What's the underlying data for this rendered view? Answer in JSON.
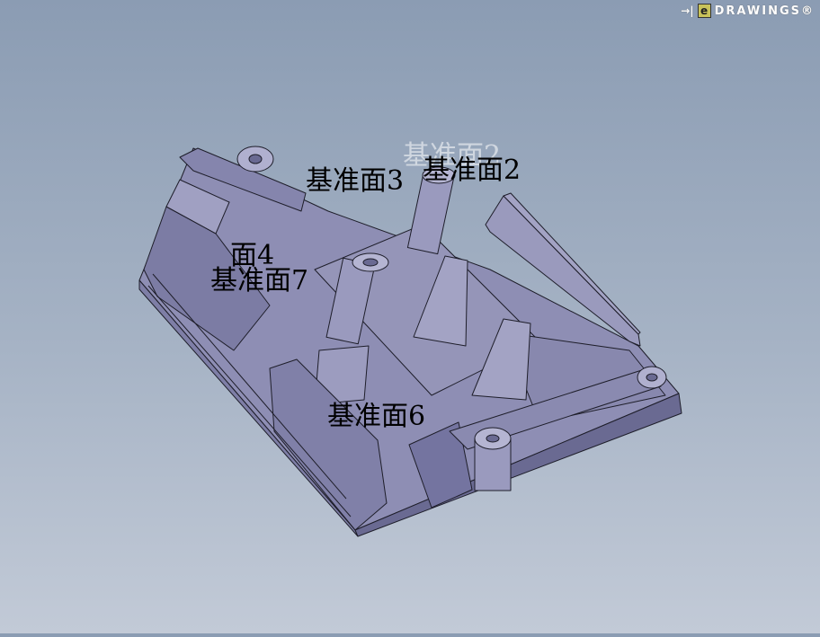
{
  "brand": {
    "text": "DRAWINGS®",
    "logo_letter": "e",
    "arrow": "→|"
  },
  "model": {
    "colors": {
      "top": "#8e8eb4",
      "side": "#7e7ea6",
      "dark": "#6a6a92",
      "light": "#a3a3c4",
      "edge": "#1e1e2a"
    }
  },
  "datum_labels": {
    "plane2": "基准面2",
    "plane2_ghost": "基准面2",
    "plane3": "基准面3",
    "plane4": "面4",
    "plane7": "基准面7",
    "plane6": "基准面6"
  }
}
